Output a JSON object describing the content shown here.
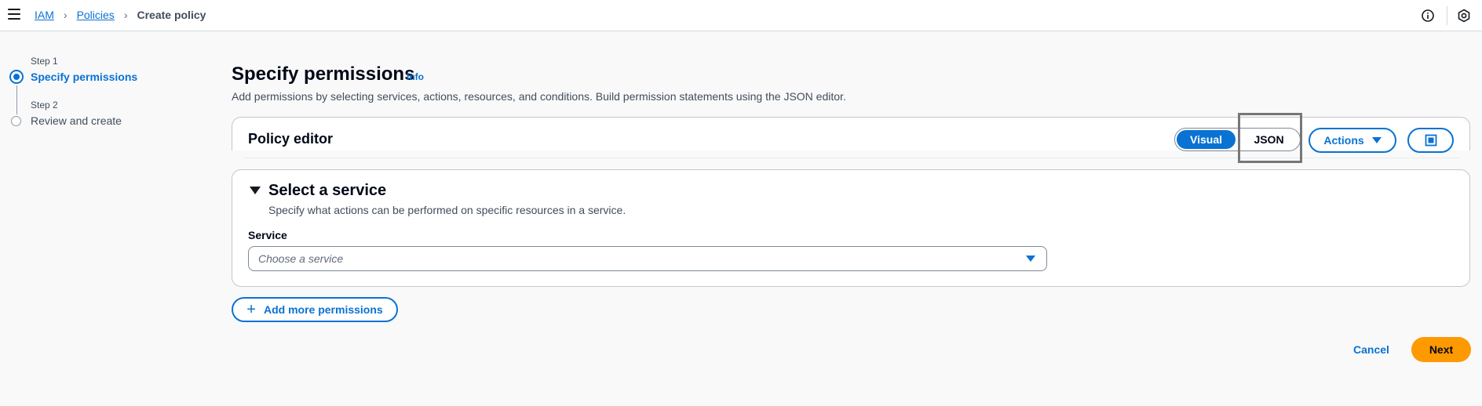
{
  "breadcrumb": {
    "items": [
      "IAM",
      "Policies"
    ],
    "current": "Create policy"
  },
  "icons": {
    "menu": "hamburger-icon",
    "info": "info-icon",
    "settings": "settings-hex-icon"
  },
  "steps": [
    {
      "label": "Step 1",
      "title": "Specify permissions",
      "state": "active"
    },
    {
      "label": "Step 2",
      "title": "Review and create",
      "state": "inactive"
    }
  ],
  "main": {
    "title": "Specify permissions",
    "info_label": "Info",
    "description": "Add permissions by selecting services, actions, resources, and conditions. Build permission statements using the JSON editor."
  },
  "policy_editor": {
    "title": "Policy editor",
    "modes": [
      "Visual",
      "JSON"
    ],
    "selected_mode": "Visual",
    "actions_label": "Actions"
  },
  "service_section": {
    "title": "Select a service",
    "description": "Specify what actions can be performed on specific resources in a service.",
    "field_label": "Service",
    "placeholder": "Choose a service"
  },
  "add_permissions_label": "Add more permissions",
  "footer": {
    "cancel_label": "Cancel",
    "next_label": "Next"
  },
  "colors": {
    "accent": "#0972d3",
    "primary_button": "#ff9900",
    "highlight_box": "#777777"
  }
}
